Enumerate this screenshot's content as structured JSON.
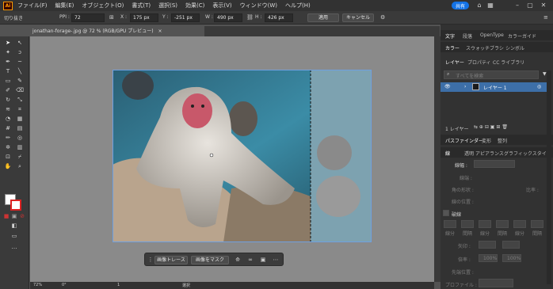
{
  "menubar": {
    "logo": "Ai",
    "items": [
      "ファイル(F)",
      "編集(E)",
      "オブジェクト(O)",
      "書式(T)",
      "選択(S)",
      "効果(C)",
      "表示(V)",
      "ウィンドウ(W)",
      "ヘルプ(H)"
    ],
    "share_label": "共有"
  },
  "controlbar": {
    "crop_label": "切り抜き",
    "ppi_label": "PPI :",
    "ppi_value": "72",
    "x_label": "X :",
    "x_value": "175 px",
    "y_label": "Y :",
    "y_value": "-251 px",
    "w_label": "W :",
    "w_value": "490 px",
    "h_label": "H :",
    "h_value": "426 px",
    "apply_label": "適用",
    "cancel_label": "キャンセル"
  },
  "document": {
    "tab_title": "jonathan-forage-.jpg @ 72 % (RGB/GPU プレビュー)",
    "tab_close": "×"
  },
  "context_bar": {
    "trace_label": "画像トレース",
    "mask_label": "画像をマスク"
  },
  "statusbar": {
    "zoom": "72%",
    "angle": "0°",
    "page": "1",
    "tool": "選択"
  },
  "panel": {
    "top_tabs": [
      "文字",
      "段落",
      "OpenType",
      "カラーガイド"
    ],
    "color_tabs": [
      "カラー",
      "スウォッチ",
      "ブラシ",
      "シンボル"
    ],
    "layer_tabs": [
      "レイヤー",
      "プロパティ",
      "CC ライブラリ"
    ],
    "search_placeholder": "すべてを検索",
    "layer_name": "レイヤー 1",
    "layer_count": "1 レイヤー",
    "pathfinder_tabs": [
      "パスファインダー",
      "変形",
      "整列"
    ],
    "stroke_tabs": [
      "線",
      "透明",
      "アピアランス",
      "グラフィックスタイル"
    ],
    "stroke_weight_label": "線幅 :",
    "cap_label": "線端 :",
    "corner_label": "角の形状 :",
    "limit_label": "比率 :",
    "align_label": "線の位置 :",
    "dashed_label": "破線",
    "dash_labels": [
      "線分",
      "間隔",
      "線分",
      "間隔",
      "線分",
      "間隔"
    ],
    "arrow_label": "矢印 :",
    "scale_label": "倍率 :",
    "scale_value_1": "100%",
    "scale_value_2": "100%",
    "position_label": "先端位置 :",
    "profile_label": "プロファイル :"
  },
  "colors": {
    "accent": "#1473e6",
    "selection_row": "#3d6fa8",
    "bg": "#535353"
  }
}
